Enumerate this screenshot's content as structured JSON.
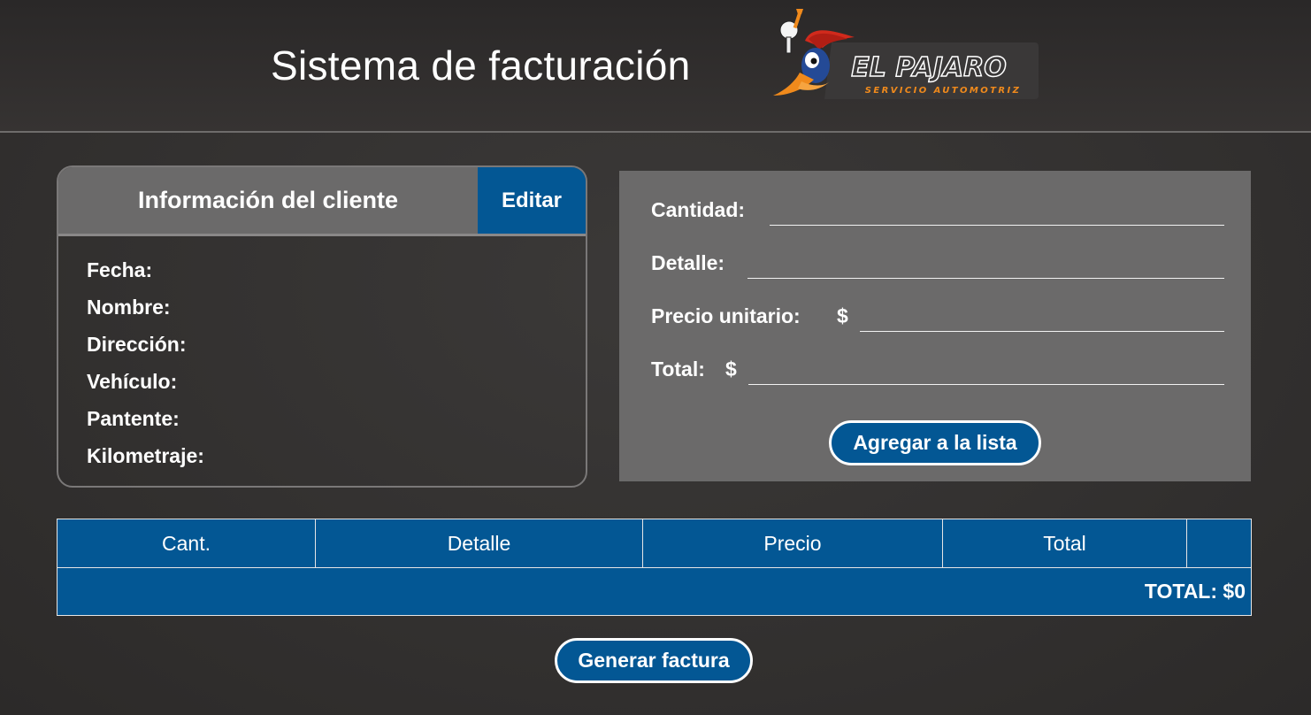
{
  "header": {
    "title": "Sistema de facturación",
    "logo": {
      "brand": "EL PAJARO",
      "tagline": "SERVICIO AUTOMOTRIZ"
    }
  },
  "client": {
    "title": "Información del cliente",
    "edit_label": "Editar",
    "fields": [
      {
        "label": "Fecha:"
      },
      {
        "label": "Nombre:"
      },
      {
        "label": "Dirección:"
      },
      {
        "label": "Vehículo:"
      },
      {
        "label": "Pantente:"
      },
      {
        "label": "Kilometraje:"
      }
    ]
  },
  "item_form": {
    "quantity_label": "Cantidad:",
    "quantity_value": "",
    "detail_label": "Detalle:",
    "detail_value": "",
    "unit_price_label": "Precio unitario:",
    "unit_price_currency": "$",
    "unit_price_value": "",
    "total_label": "Total:",
    "total_currency": "$",
    "total_value": "",
    "add_label": "Agregar a la lista"
  },
  "items_table": {
    "columns": [
      "Cant.",
      "Detalle",
      "Precio",
      "Total",
      ""
    ],
    "rows": [],
    "grand_total": "TOTAL: $0"
  },
  "generate_label": "Generar factura",
  "colors": {
    "accent_blue": "#035794",
    "panel_gray": "#6b6a6a",
    "background": "#353332",
    "logo_orange": "#f08a1c"
  }
}
